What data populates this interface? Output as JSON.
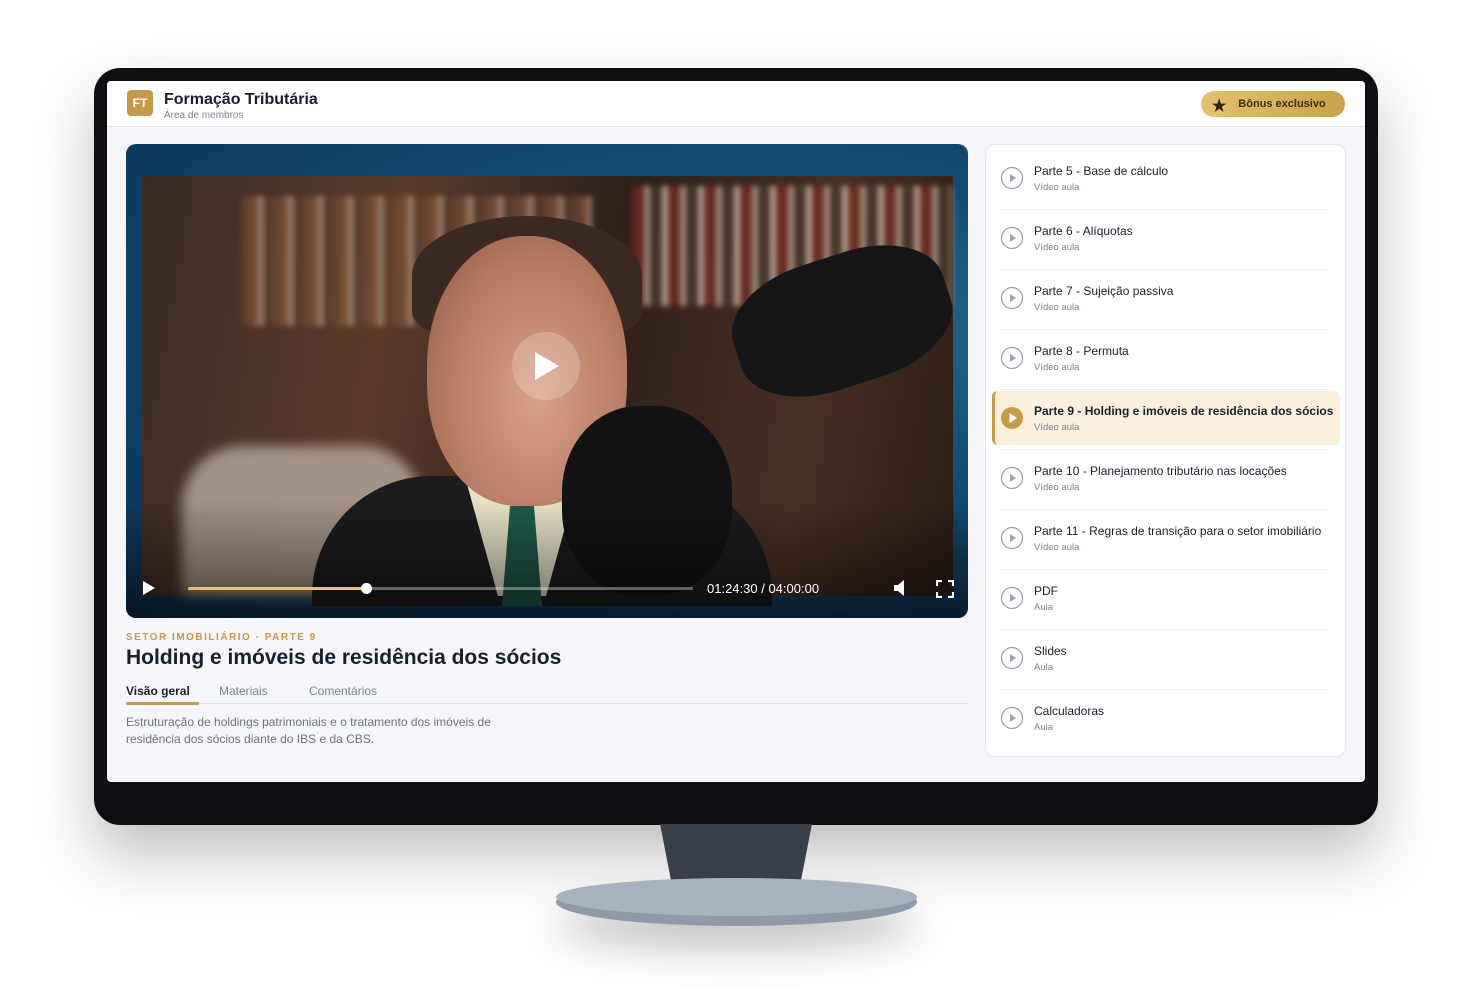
{
  "header": {
    "logo_text": "FT",
    "title": "Formação Tributária",
    "subtitle": "Área de membros",
    "bonus_button": "Bônus exclusivo"
  },
  "player": {
    "current_time": "01:24:30",
    "duration": "04:00:00",
    "time_display": "01:24:30 / 04:00:00",
    "progress": 0.352
  },
  "lesson": {
    "kicker": "SETOR IMOBILIÁRIO · PARTE 9",
    "title": "Holding e imóveis de residência dos sócios",
    "tabs": [
      {
        "label": "Visão geral",
        "active": true
      },
      {
        "label": "Materiais",
        "active": false
      },
      {
        "label": "Comentários",
        "active": false
      }
    ],
    "description": "Estruturação de holdings patrimoniais e o tratamento dos imóveis de residência dos sócios diante do IBS e da CBS."
  },
  "playlist": [
    {
      "title": "Parte 5 - Base de cálculo",
      "type": "Vídeo aula",
      "active": false
    },
    {
      "title": "Parte 6 - Alíquotas",
      "type": "Vídeo aula",
      "active": false
    },
    {
      "title": "Parte 7 - Sujeição passiva",
      "type": "Vídeo aula",
      "active": false
    },
    {
      "title": "Parte 8 - Permuta",
      "type": "Vídeo aula",
      "active": false
    },
    {
      "title": "Parte 9 - Holding e imóveis de residência dos sócios",
      "type": "Vídeo aula",
      "active": true
    },
    {
      "title": "Parte 10 - Planejamento tributário nas locações",
      "type": "Vídeo aula",
      "active": false
    },
    {
      "title": "Parte 11 - Regras de transição para o setor imobiliário",
      "type": "Vídeo aula",
      "active": false
    },
    {
      "title": "PDF",
      "type": "Aula",
      "active": false
    },
    {
      "title": "Slides",
      "type": "Aula",
      "active": false
    },
    {
      "title": "Calculadoras",
      "type": "Aula",
      "active": false
    }
  ],
  "colors": {
    "accent": "#c79a45",
    "active_row": "#fbf0dc",
    "text_primary": "#17202e",
    "text_muted": "#7a8494"
  },
  "icons": [
    "play-icon",
    "volume-icon",
    "fullscreen-icon",
    "star-icon",
    "play-circle-icon"
  ]
}
